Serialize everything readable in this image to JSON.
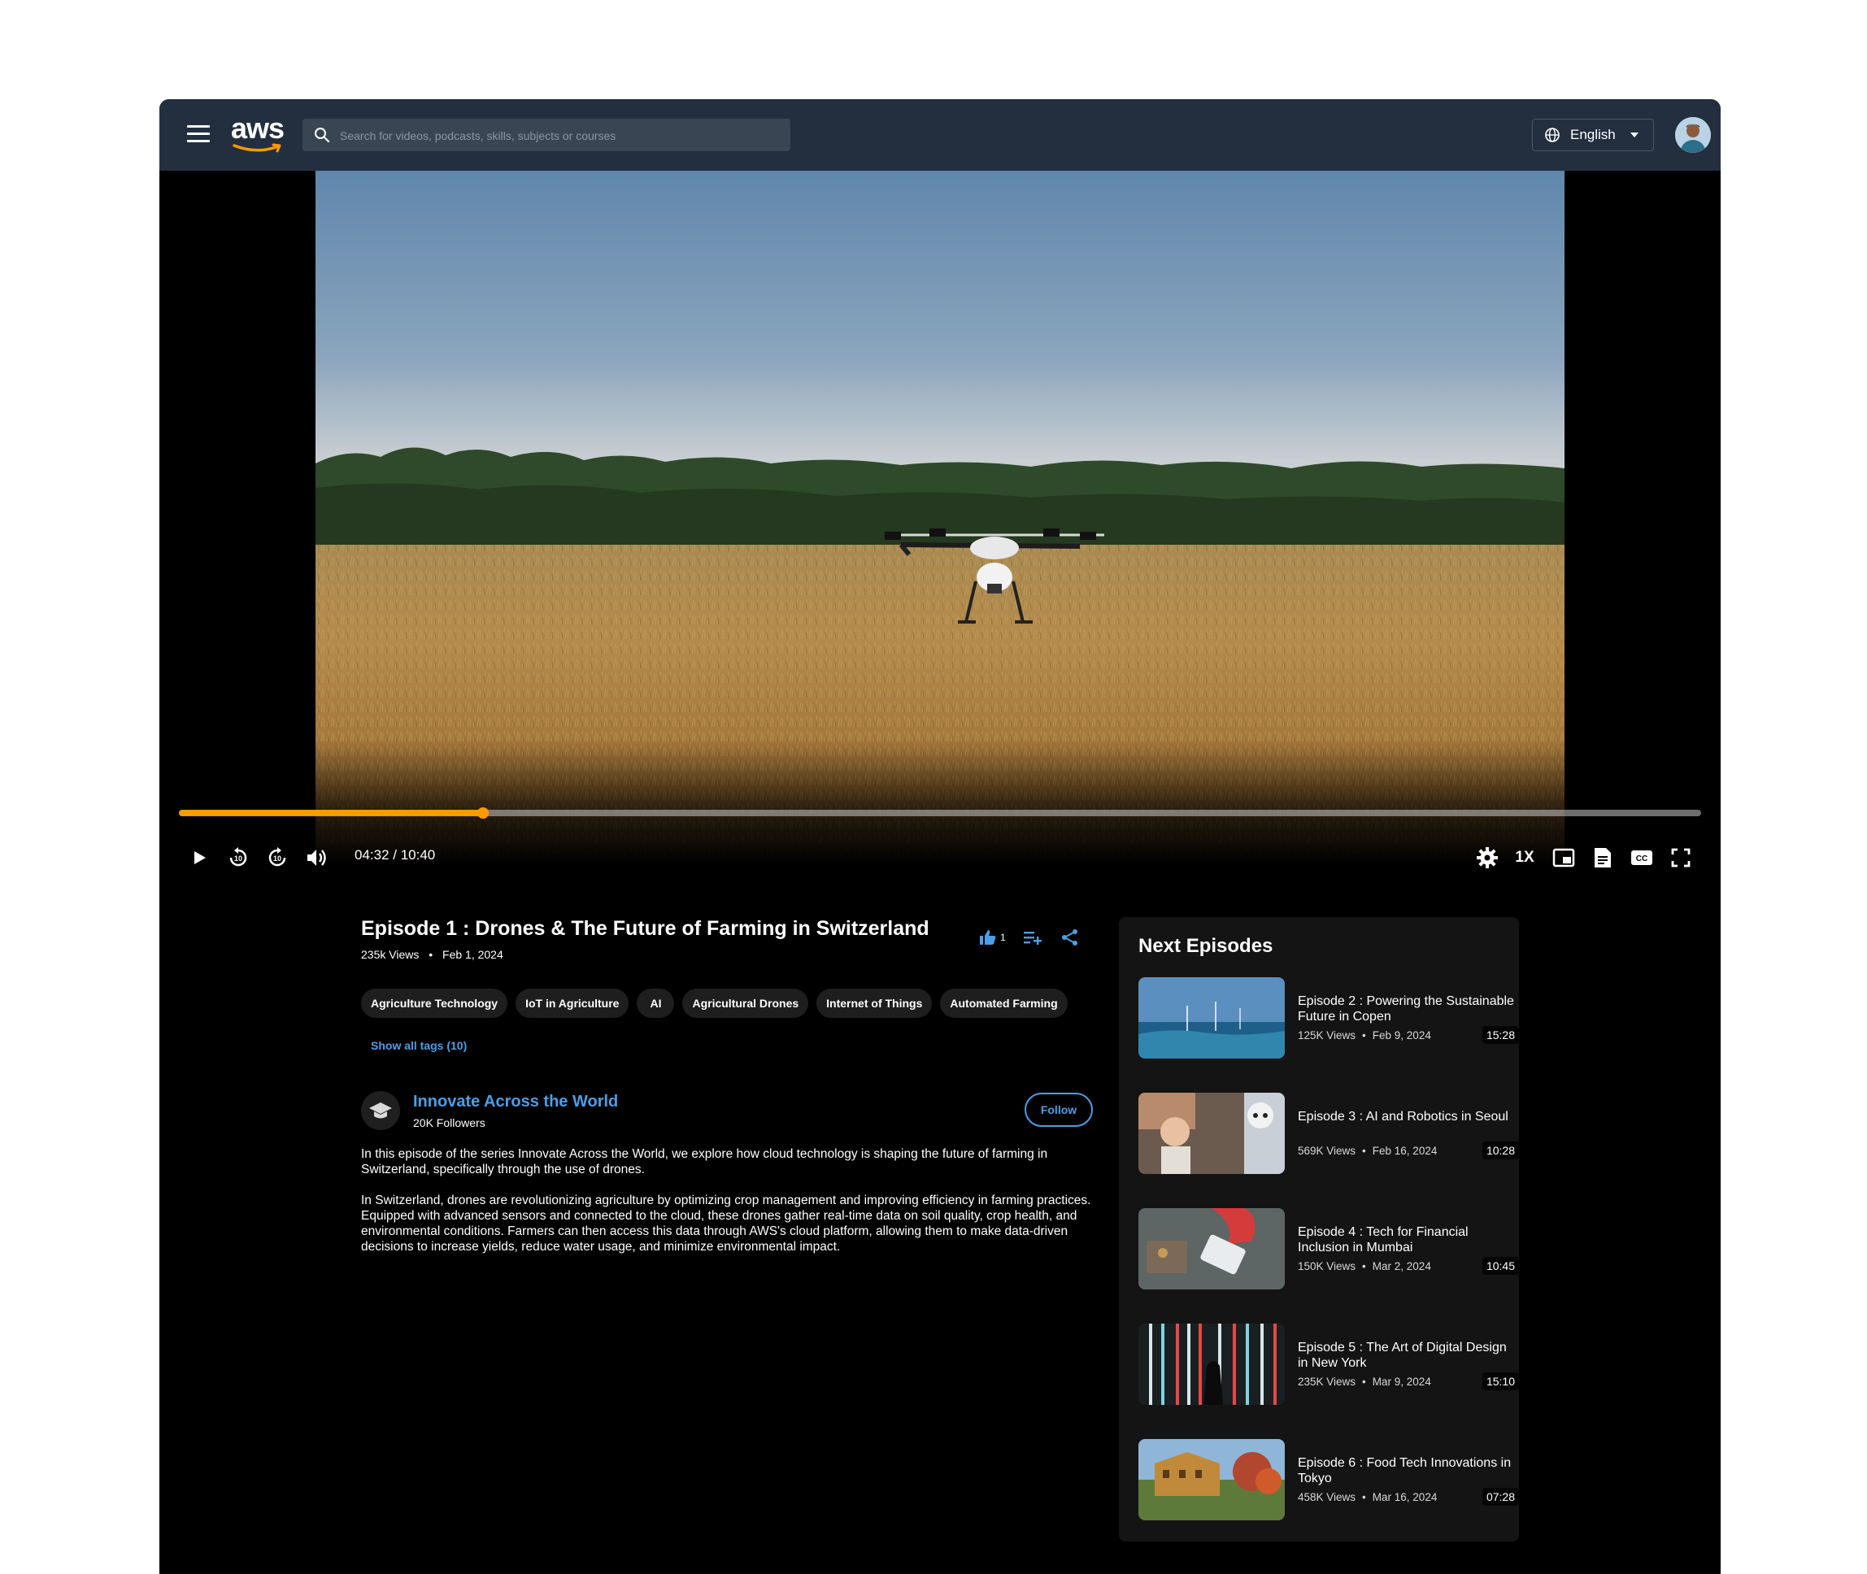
{
  "header": {
    "logo_text": "aws",
    "search_placeholder": "Search for videos, podcasts, skills, subjects or courses",
    "language": "English"
  },
  "player": {
    "time_display": "04:32 / 10:40",
    "progress_fraction": 0.2,
    "speed_label": "1X",
    "accent_color": "#ff9900"
  },
  "episode": {
    "title": "Episode 1 : Drones & The Future of Farming in Switzerland",
    "views": "235k Views",
    "date": "Feb 1, 2024",
    "like_count": "1",
    "tags": [
      "Agriculture Technology",
      "IoT in Agriculture",
      "AI",
      "Agricultural Drones",
      "Internet of Things",
      "Automated Farming"
    ],
    "show_all_tags": "Show all tags (10)",
    "description": [
      "In this episode of the series Innovate Across the World, we explore how cloud technology is shaping the future of farming in Switzerland, specifically through the use of drones.",
      "In Switzerland, drones are revolutionizing agriculture by optimizing crop management and improving efficiency in farming practices. Equipped with advanced sensors and connected to the cloud, these drones gather real-time data on soil quality, crop health, and environmental conditions. Farmers can then access this data through AWS's cloud platform, allowing them to make data-driven decisions to increase yields, reduce water usage, and minimize environmental impact."
    ]
  },
  "channel": {
    "name": "Innovate Across the World",
    "followers": "20K Followers",
    "follow_label": "Follow",
    "link_color": "#4a9fe8"
  },
  "next_episodes": {
    "heading": "Next Episodes",
    "items": [
      {
        "title": "Episode 2 : Powering the Sustainable Future in Copen",
        "views": "125K Views",
        "date": "Feb 9, 2024",
        "duration": "15:28"
      },
      {
        "title": "Episode 3 : AI and Robotics in Seoul",
        "views": "569K Views",
        "date": "Feb 16, 2024",
        "duration": "10:28"
      },
      {
        "title": "Episode 4 : Tech for Financial Inclusion in Mumbai",
        "views": "150K Views",
        "date": "Mar 2, 2024",
        "duration": "10:45"
      },
      {
        "title": "Episode 5 : The Art of Digital Design in New York",
        "views": "235K Views",
        "date": "Mar 9, 2024",
        "duration": "15:10"
      },
      {
        "title": "Episode 6 : Food Tech Innovations in Tokyo",
        "views": "458K Views",
        "date": "Mar 16, 2024",
        "duration": "07:28"
      }
    ]
  }
}
